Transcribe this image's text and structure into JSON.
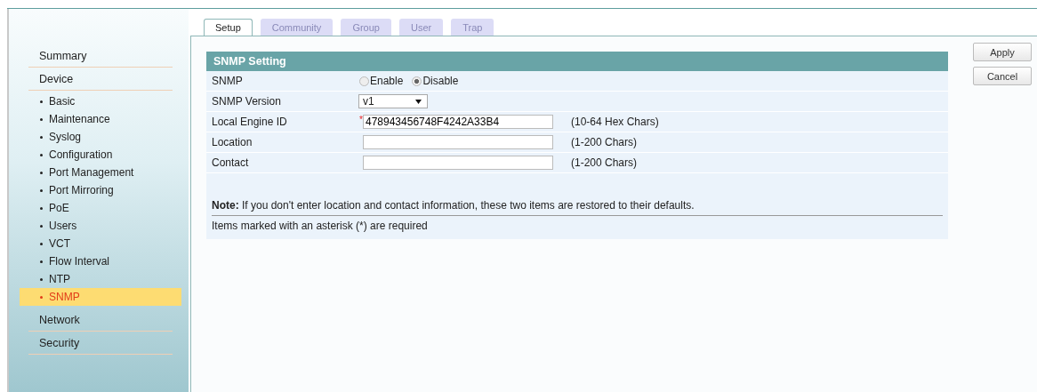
{
  "tabs": [
    {
      "label": "Setup",
      "selected": true,
      "disabled": false
    },
    {
      "label": "Community",
      "selected": false,
      "disabled": true
    },
    {
      "label": "Group",
      "selected": false,
      "disabled": true
    },
    {
      "label": "User",
      "selected": false,
      "disabled": true
    },
    {
      "label": "Trap",
      "selected": false,
      "disabled": true
    }
  ],
  "sidebar": {
    "items": [
      {
        "label": "Summary",
        "selected": false
      },
      {
        "label": "Device",
        "selected": false,
        "children": [
          {
            "label": "Basic",
            "selected": false
          },
          {
            "label": "Maintenance",
            "selected": false
          },
          {
            "label": "Syslog",
            "selected": false
          },
          {
            "label": "Configuration",
            "selected": false
          },
          {
            "label": "Port Management",
            "selected": false
          },
          {
            "label": "Port Mirroring",
            "selected": false
          },
          {
            "label": "PoE",
            "selected": false
          },
          {
            "label": "Users",
            "selected": false
          },
          {
            "label": "VCT",
            "selected": false
          },
          {
            "label": "Flow Interval",
            "selected": false
          },
          {
            "label": "NTP",
            "selected": false
          },
          {
            "label": "SNMP",
            "selected": true
          }
        ]
      },
      {
        "label": "Network",
        "selected": false
      },
      {
        "label": "Security",
        "selected": false
      }
    ]
  },
  "panel": {
    "title": "SNMP Setting",
    "rows": [
      {
        "kind": "radio",
        "label": "SNMP",
        "options": [
          {
            "label": "Enable",
            "selected": false
          },
          {
            "label": "Disable",
            "selected": true
          }
        ]
      },
      {
        "kind": "select",
        "label": "SNMP Version",
        "value": "v1"
      },
      {
        "kind": "text",
        "label": "Local Engine ID",
        "value": "478943456748F4242A33B4",
        "marker": "*",
        "hint": "(10-64 Hex Chars)"
      },
      {
        "kind": "text",
        "label": "Location",
        "hint": "(1-200 Chars)"
      },
      {
        "kind": "text",
        "label": "Contact",
        "hint": "(1-200 Chars)"
      }
    ],
    "note": "**Note:** If you don't enter location and contact information, these two items are restored to their defaults.",
    "footnote": "Items marked with an asterisk (*) are required"
  },
  "buttons": [
    "Apply",
    "Cancel"
  ]
}
